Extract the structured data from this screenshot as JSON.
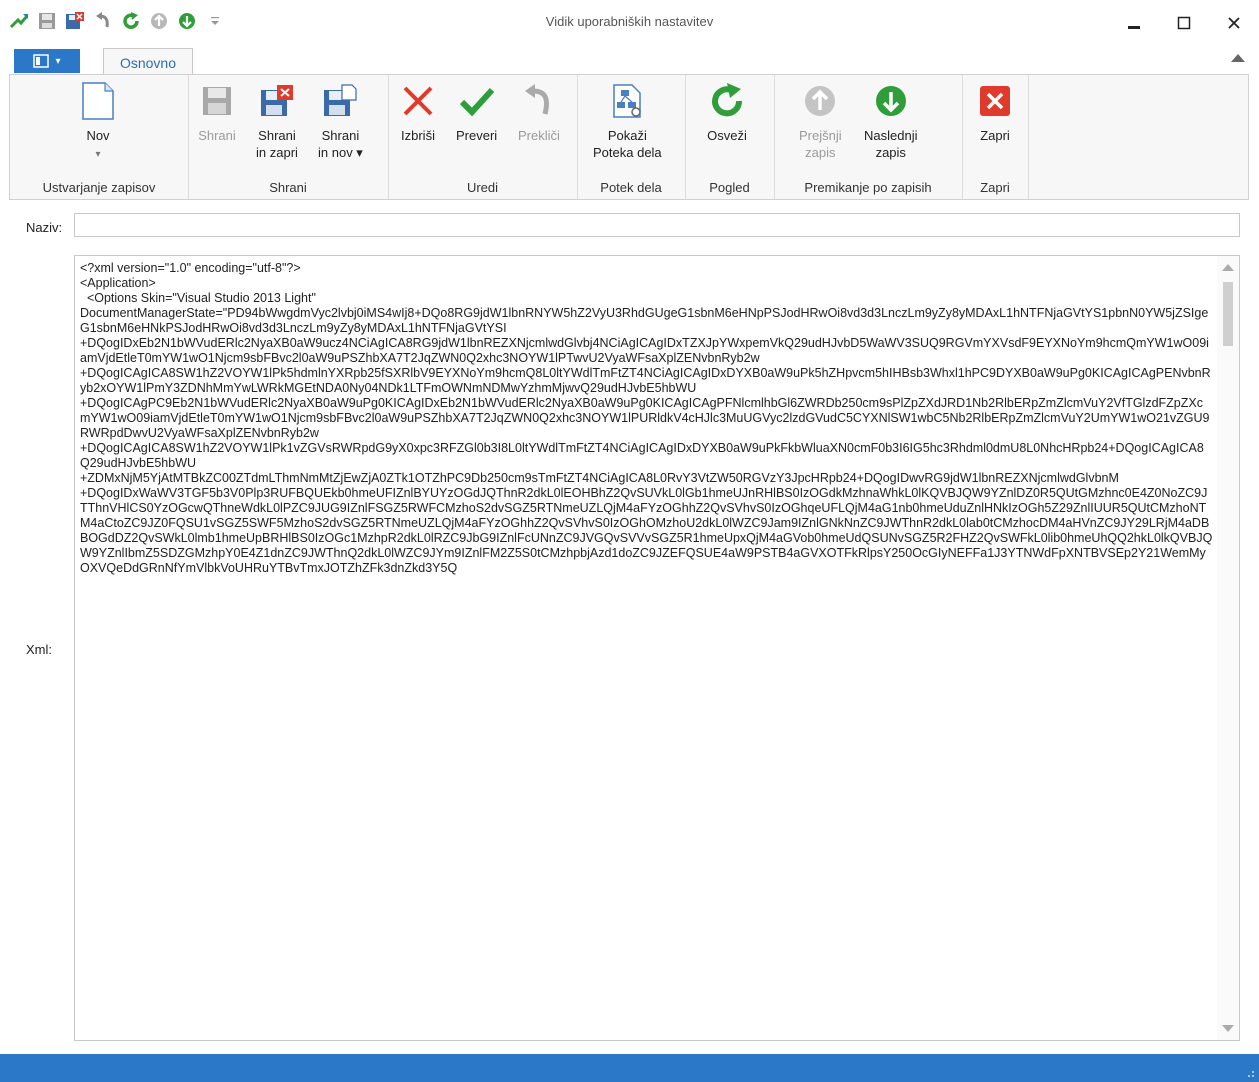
{
  "window": {
    "title": "Vidik uporabniških nastavitev"
  },
  "tabs": {
    "file_label": "▯▾",
    "home_label": "Osnovno"
  },
  "ribbon": {
    "groups": {
      "ustvarjanje": "Ustvarjanje zapisov",
      "shrani": "Shrani",
      "uredi": "Uredi",
      "potek": "Potek dela",
      "pogled": "Pogled",
      "premikanje": "Premikanje po zapisih",
      "zapri": "Zapri"
    },
    "buttons": {
      "nov": "Nov",
      "shrani": "Shrani",
      "shrani_zapri_1": "Shrani",
      "shrani_zapri_2": "in zapri",
      "shrani_nov_1": "Shrani",
      "shrani_nov_2": "in nov ▾",
      "izbrisi": "Izbriši",
      "preveri": "Preveri",
      "preklici": "Prekliči",
      "pokazi_1": "Pokaži",
      "pokazi_2": "Poteka dela",
      "osvezi": "Osveži",
      "prejsnji_1": "Prejšnji",
      "prejsnji_2": "zapis",
      "naslednji_1": "Naslednji",
      "naslednji_2": "zapis",
      "zapri": "Zapri"
    }
  },
  "colors": {
    "accent": "#2b78c8",
    "status_bar": "#2b78c8",
    "green": "#2f9e3a",
    "red": "#e03a2c"
  },
  "form": {
    "naziv_label": "Naziv:",
    "naziv_value": "",
    "xml_label": "Xml:",
    "xml_value": "<?xml version=\"1.0\" encoding=\"utf-8\"?>\n<Application>\n  <Options Skin=\"Visual Studio 2013 Light\"\nDocumentManagerState=\"PD94bWwgdmVyc2lvbj0iMS4wIj8+DQo8RG9jdW1lbnRNYW5hZ2VyU3RhdGUgeG1sbnM6eHNpPSJodHRwOi8vd3d3LnczLm9yZy8yMDAxL1hNTFNjaGVtYS1pbnN0YW5jZSIgeG1sbnM6eHNkPSJodHRwOi8vd3d3LnczLm9yZy8yMDAxL1hNTFNjaGVtYSI\n+DQogIDxEb2N1bWVudERlc2NyaXB0aW9ucz4NCiAgICA8RG9jdW1lbnREZXNjcmlwdGlvbj4NCiAgICAgIDxTZXJpYWxpemVkQ29udHJvbD5WaWV3SUQ9RGVmYXVsdF9EYXNoYm9hcmQmYW1wO09iamVjdEtleT0mYW1wO1Njcm9sbFBvc2l0aW9uPSZhbXA7T2JqZWN0Q2xhc3NOYW1lPTwvU2VyaWFsaXplZENvbnRyb2w\n+DQogICAgICA8SW1hZ2VOYW1lPk5hdmlnYXRpb25fSXRlbV9EYXNoYm9hcmQ8L0ltYWdlTmFtZT4NCiAgICAgIDxDYXB0aW9uPk5hZHpvcm5hIHBsb3Whxl1hPC9DYXB0aW9uPg0KICAgICAgPENvbnRyb2xOYW1lPmY3ZDNhMmYwLWRkMGEtNDA0Ny04NDk1LTFmOWNmNDMwYzhmMjwvQ29udHJvbE5hbWU\n+DQogICAgPC9Eb2N1bWVudERlc2NyaXB0aW9uPg0KICAgIDxEb2N1bWVudERlc2NyaXB0aW9uPg0KICAgICAgPFNlcmlhbGl6ZWRDb250cm9sPlZpZXdJRD1Nb2RlbERpZmZlcmVuY2VfTGlzdFZpZXcmYW1wO09iamVjdEtleT0mYW1wO1Njcm9sbFBvc2l0aW9uPSZhbXA7T2JqZWN0Q2xhc3NOYW1lPURldkV4cHJlc3MuUGVyc2lzdGVudC5CYXNlSW1wbC5Nb2RlbERpZmZlcmVuY2UmYW1wO21vZGU9RWRpdDwvU2VyaWFsaXplZENvbnRyb2w\n+DQogICAgICA8SW1hZ2VOYW1lPk1vZGVsRWRpdG9yX0xpc3RFZGl0b3I8L0ltYWdlTmFtZT4NCiAgICAgIDxDYXB0aW9uPkFkbWluaXN0cmF0b3I6IG5hc3Rhdml0dmU8L0NhcHRpb24+DQogICAgICA8Q29udHJvbE5hbWU\n+ZDMxNjM5YjAtMTBkZC00ZTdmLThmNmMtZjEwZjA0ZTk1OTZhPC9Db250cm9sTmFtZT4NCiAgICA8L0RvY3VtZW50RGVzY3JpcHRpb24+DQogIDwvRG9jdW1lbnREZXNjcmlwdGlvbnM\n+DQogIDxWaWV3TGF5b3V0Plp3RUFBQUEkb0hmeUFIZnlBYUYzOGdJQThnR2dkL0lEOHBhZ2QvSUVkL0lGb1hmeUJnRHlBS0IzOGdkMzhnaWhkL0lKQVBJQW9YZnlDZ0R5QUtGMzhnc0E4Z0NoZC9JTThnVHlCS0YzOGcwQThneWdkL0lPZC9JUG9IZnlFSGZ5RWFCMzhoS2dvSGZ5RTNmeUZLQjM4aFYzOGhhZ2QvSVhvS0IzOGhqeUFLQjM4aG1nb0hmeUduZnlHNkIzOGh5Z29ZnlIUUR5QUtCMzhoNTM4aCtoZC9JZ0FQSU1vSGZ5SWF5MzhoS2dvSGZ5RTNmeUZLQjM4aFYzOGhhZ2QvSVhvS0IzOGhOMzhoU2dkL0lWZC9Jam9IZnlGNkNnZC9JWThnR2dkL0lab0tCMzhocDM4aHVnZC9JY29LRjM4aDBBOGdDZ2QvSWkL0lmb1hmeUpBRHlBS0IzOGc1MzhpR2dkL0lRZC9JbG9IZnlFcUNnZC9JVGQvSVVvSGZ5R1hmeUpxQjM4aGVob0hmeUdQSUNvSGZ5R2FHZ2QvSWFkL0lib0hmeUhQQ2hkL0lkQVBJQW9YZnlIbmZ5SDZGMzhpY0E4Z1dnZC9JWThnQ2dkL0lWZC9JYm9IZnlFM2Z5S0tCMzhpbjAzd1doZC9JZEFQSUE4aW9PSTB4aGVXOTFkRlpsY250OcGIyNEFFa1J3YTNWdFpXNTBVSEp2Y21WemMyOXVQeDdGRnNfYmVlbkVoUHRuYTBvTmxJOTZhZFk3dnZkd3Y5Q\n"
  }
}
